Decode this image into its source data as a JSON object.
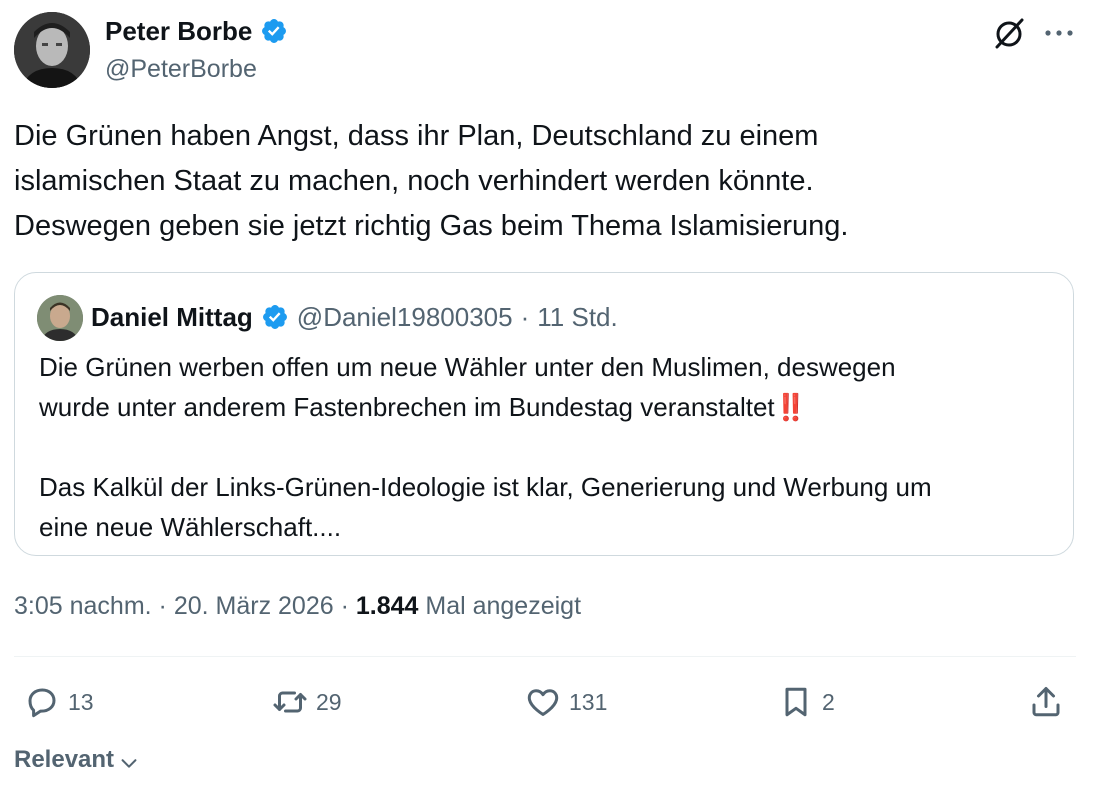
{
  "author": {
    "name": "Peter Borbe",
    "handle": "@PeterBorbe",
    "verified": true
  },
  "tweet": {
    "text": "Die Grünen haben Angst, dass ihr Plan, Deutschland zu einem\nislamischen Staat zu machen, noch verhindert werden könnte.\nDeswegen geben sie jetzt richtig Gas beim Thema Islamisierung."
  },
  "quote": {
    "name": "Daniel Mittag",
    "handle": "@Daniel19800305",
    "separator": "·",
    "time": "11 Std.",
    "verified": true,
    "text_line1": "Die Grünen werben offen um neue Wähler unter den Muslimen, deswegen\nwurde unter anderem Fastenbrechen im Bundestag veranstaltet",
    "emphasis": "‼️",
    "text_line2": "\n\nDas Kalkül der Links-Grünen-Ideologie ist klar, Generierung und Werbung um\neine neue Wählerschaft...."
  },
  "meta": {
    "time": "3:05 nachm.",
    "sep1": " · ",
    "date": "20. März 2026",
    "sep2": " · ",
    "views": "1.844",
    "views_label": " Mal angezeigt"
  },
  "actions": {
    "replies": "13",
    "retweets": "29",
    "likes": "131",
    "bookmarks": "2"
  },
  "sort": {
    "label": "Relevant"
  },
  "icons": {
    "verified_badge": "verified-badge-icon",
    "grok": "grok-icon",
    "more": "more-icon",
    "reply": "reply-icon",
    "retweet": "retweet-icon",
    "like": "heart-icon",
    "bookmark": "bookmark-icon",
    "share": "share-icon",
    "chevron": "chevron-down-icon"
  },
  "colors": {
    "verified": "#1d9bf0",
    "text": "#0f1419",
    "secondary": "#536471",
    "border": "#cfd9de",
    "emphasis": "#e0245e"
  }
}
